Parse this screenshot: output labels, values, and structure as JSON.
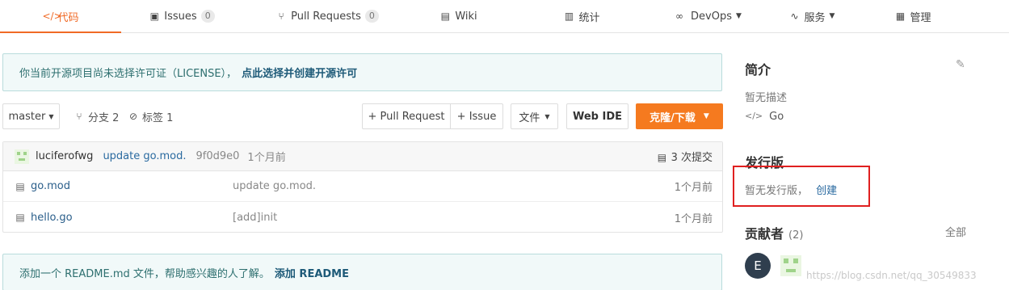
{
  "nav": {
    "tabs": [
      {
        "label": "代码",
        "icon": "code-icon"
      },
      {
        "label": "Issues",
        "count": "0"
      },
      {
        "label": "Pull Requests",
        "count": "0"
      },
      {
        "label": "Wiki"
      },
      {
        "label": "统计"
      },
      {
        "label": "DevOps"
      },
      {
        "label": "服务"
      },
      {
        "label": "管理"
      }
    ]
  },
  "license_banner": {
    "text": "你当前开源项目尚未选择许可证（LICENSE），",
    "link": "点此选择并创建开源许可"
  },
  "toolbar": {
    "branch": "master",
    "branches": "分支 2",
    "tags": "标签 1",
    "pull_request": "+ Pull Request",
    "issue": "+ Issue",
    "file": "文件",
    "web_ide": "Web IDE",
    "clone": "克隆/下载"
  },
  "commit": {
    "author": "luciferofwg",
    "message": "update go.mod.",
    "hash": "9f0d9e0",
    "time": "1个月前",
    "count": "3 次提交"
  },
  "files": [
    {
      "name": "go.mod",
      "message": "update go.mod.",
      "time": "1个月前"
    },
    {
      "name": "hello.go",
      "message": "[add]init",
      "time": "1个月前"
    }
  ],
  "readme_banner": {
    "text": "添加一个 README.md 文件，帮助感兴趣的人了解。",
    "link": "添加 README"
  },
  "sidebar": {
    "intro_title": "简介",
    "intro_desc": "暂无描述",
    "language": "Go",
    "release_title": "发行版",
    "release_text": "暂无发行版，",
    "release_link": "创建",
    "contrib_title": "贡献者",
    "contrib_count": "(2)",
    "contrib_all": "全部",
    "contrib_avatar_letter": "E"
  },
  "watermark": "https://blog.csdn.net/qq_30549833",
  "colors": {
    "accent": "#f06a26",
    "clone_button": "#f57a1f",
    "highlight_box": "#e02020"
  }
}
